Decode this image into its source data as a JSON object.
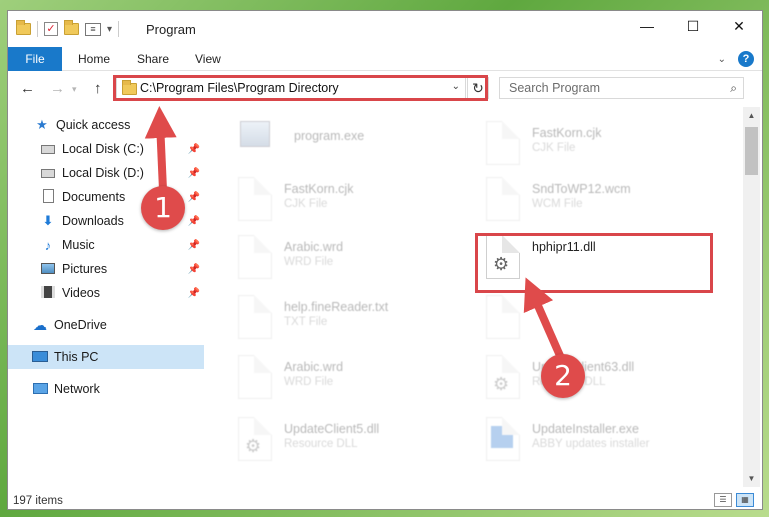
{
  "window": {
    "title": "Program",
    "controls": {
      "minimize": "—",
      "maximize": "☐",
      "close": "✕"
    }
  },
  "ribbon": {
    "tabs": [
      "File",
      "Home",
      "Share",
      "View"
    ]
  },
  "navigation": {
    "back": "←",
    "forward": "→",
    "up": "↑",
    "address": "C:\\Program Files\\Program Directory",
    "search_placeholder": "Search Program"
  },
  "sidebar": {
    "items": [
      {
        "label": "Quick access",
        "icon": "star-icon"
      },
      {
        "label": "Local Disk (C:)",
        "icon": "drive-icon",
        "pinned": true
      },
      {
        "label": "Local Disk (D:)",
        "icon": "drive-icon",
        "pinned": true
      },
      {
        "label": "Documents",
        "icon": "documents-icon",
        "pinned": true
      },
      {
        "label": "Downloads",
        "icon": "downloads-icon",
        "pinned": true
      },
      {
        "label": "Music",
        "icon": "music-icon",
        "pinned": true
      },
      {
        "label": "Pictures",
        "icon": "pictures-icon",
        "pinned": true
      },
      {
        "label": "Videos",
        "icon": "videos-icon",
        "pinned": true
      },
      {
        "label": "OneDrive",
        "icon": "onedrive-icon"
      },
      {
        "label": "This PC",
        "icon": "pc-icon",
        "selected": true
      },
      {
        "label": "Network",
        "icon": "network-icon"
      }
    ]
  },
  "files": [
    {
      "name": "program.exe",
      "type": "",
      "faded": true
    },
    {
      "name": "FastKorn.cjk",
      "type": "CJK File",
      "faded": true
    },
    {
      "name": "FastKorn.cjk",
      "type": "CJK File",
      "faded": true
    },
    {
      "name": "SndToWP12.wcm",
      "type": "WCM File",
      "faded": true
    },
    {
      "name": "Arabic.wrd",
      "type": "WRD File",
      "faded": true
    },
    {
      "name": "hphipr11.dll",
      "type": "",
      "faded": false
    },
    {
      "name": "help.fineReader.txt",
      "type": "TXT File",
      "faded": true
    },
    {
      "name": "",
      "type": "",
      "faded": true
    },
    {
      "name": "Arabic.wrd",
      "type": "WRD File",
      "faded": true
    },
    {
      "name": "UpdateClient63.dll",
      "type": "Resource DLL",
      "faded": true
    },
    {
      "name": "UpdateClient5.dll",
      "type": "Resource DLL",
      "faded": true
    },
    {
      "name": "UpdateInstaller.exe",
      "type": "ABBY updates installer",
      "faded": true
    }
  ],
  "status": {
    "item_count": "197 items"
  },
  "annotations": {
    "step1": "1",
    "step2": "2",
    "color": "#df4b4b"
  }
}
